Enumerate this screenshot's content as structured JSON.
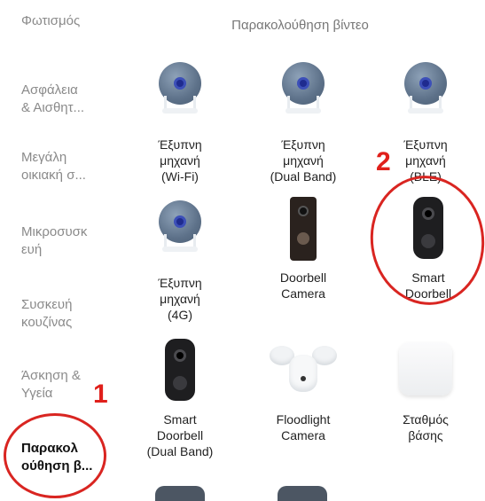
{
  "sidebar": {
    "items": [
      {
        "label": "Φωτισμός"
      },
      {
        "label": "Ασφάλεια\n& Αισθητ..."
      },
      {
        "label": "Μεγάλη\nοικιακή σ..."
      },
      {
        "label": "Μικροσυσκ\nευή"
      },
      {
        "label": "Συσκευή\nκουζίνας"
      },
      {
        "label": "Άσκηση &\nΥγεία"
      },
      {
        "label": "Παρακολ\nούθηση β..."
      }
    ]
  },
  "section": {
    "title": "Παρακολούθηση βίντεο"
  },
  "devices": [
    {
      "label": "Έξυπνη\nμηχανή\n(Wi-Fi)",
      "icon": "camera-icon"
    },
    {
      "label": "Έξυπνη\nμηχανή\n(Dual Band)",
      "icon": "camera-icon"
    },
    {
      "label": "Έξυπνη\nμηχανή\n(BLE)",
      "icon": "camera-icon"
    },
    {
      "label": "Έξυπνη\nμηχανή\n(4G)",
      "icon": "camera-icon"
    },
    {
      "label": "Doorbell\nCamera",
      "icon": "doorbell-camera-icon"
    },
    {
      "label": "Smart\nDoorbell",
      "icon": "smart-doorbell-icon"
    },
    {
      "label": "Smart\nDoorbell\n(Dual Band)",
      "icon": "smart-doorbell-icon"
    },
    {
      "label": "Floodlight\nCamera",
      "icon": "floodlight-camera-icon"
    },
    {
      "label": "Σταθμός\nβάσης",
      "icon": "base-station-icon"
    }
  ],
  "annotations": {
    "one": "1",
    "two": "2",
    "color": "#e0201b"
  }
}
